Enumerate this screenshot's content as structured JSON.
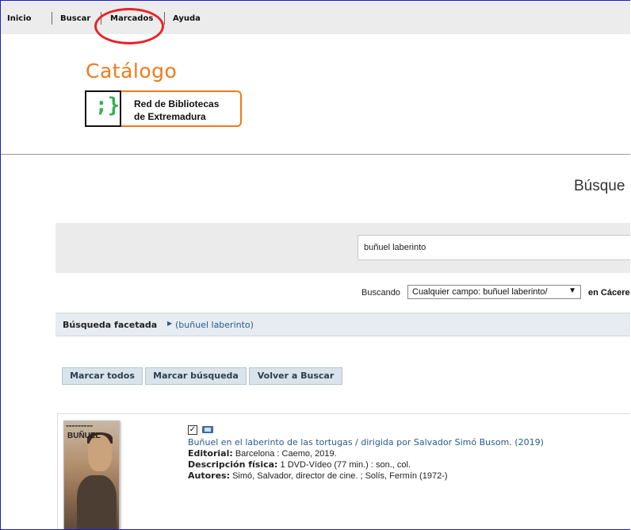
{
  "nav": {
    "items": [
      "Inicio",
      "Buscar",
      "Marcados",
      "Ayuda"
    ]
  },
  "header": {
    "title": "Catálogo",
    "logo_glyph": ";}",
    "logo_line1": "Red de Bibliotecas",
    "logo_line2": "de Extremadura"
  },
  "page": {
    "heading": "Búsque"
  },
  "search": {
    "query": "buñuel laberinto",
    "buscando_label": "Buscando",
    "field_select": "Cualquier campo: buñuel laberinto/",
    "location_label": "en Cácere"
  },
  "facets": {
    "label": "Búsqueda facetada",
    "crumb": "(buñuel laberinto)"
  },
  "actions": {
    "mark_all": "Marcar todos",
    "mark_search": "Marcar búsqueda",
    "back_search": "Volver a Buscar"
  },
  "result": {
    "title": "Buñuel en el laberinto de las tortugas / dirigida por Salvador Simó Busom. (2019)",
    "editorial_label": "Editorial:",
    "editorial": "Barcelona : Caemo, 2019.",
    "physical_label": "Descripción física:",
    "physical": "1 DVD-Vídeo (77 min.) : son., col.",
    "authors_label": "Autores:",
    "authors": "Simó, Salvador, director de cine. ; Solís, Fermín (1972-)",
    "checked": true
  },
  "colors": {
    "brand_orange": "#f07a1a",
    "link_blue": "#2a5a8a",
    "annotation_red": "#e8222b",
    "button_bg": "#d9e3ec"
  }
}
